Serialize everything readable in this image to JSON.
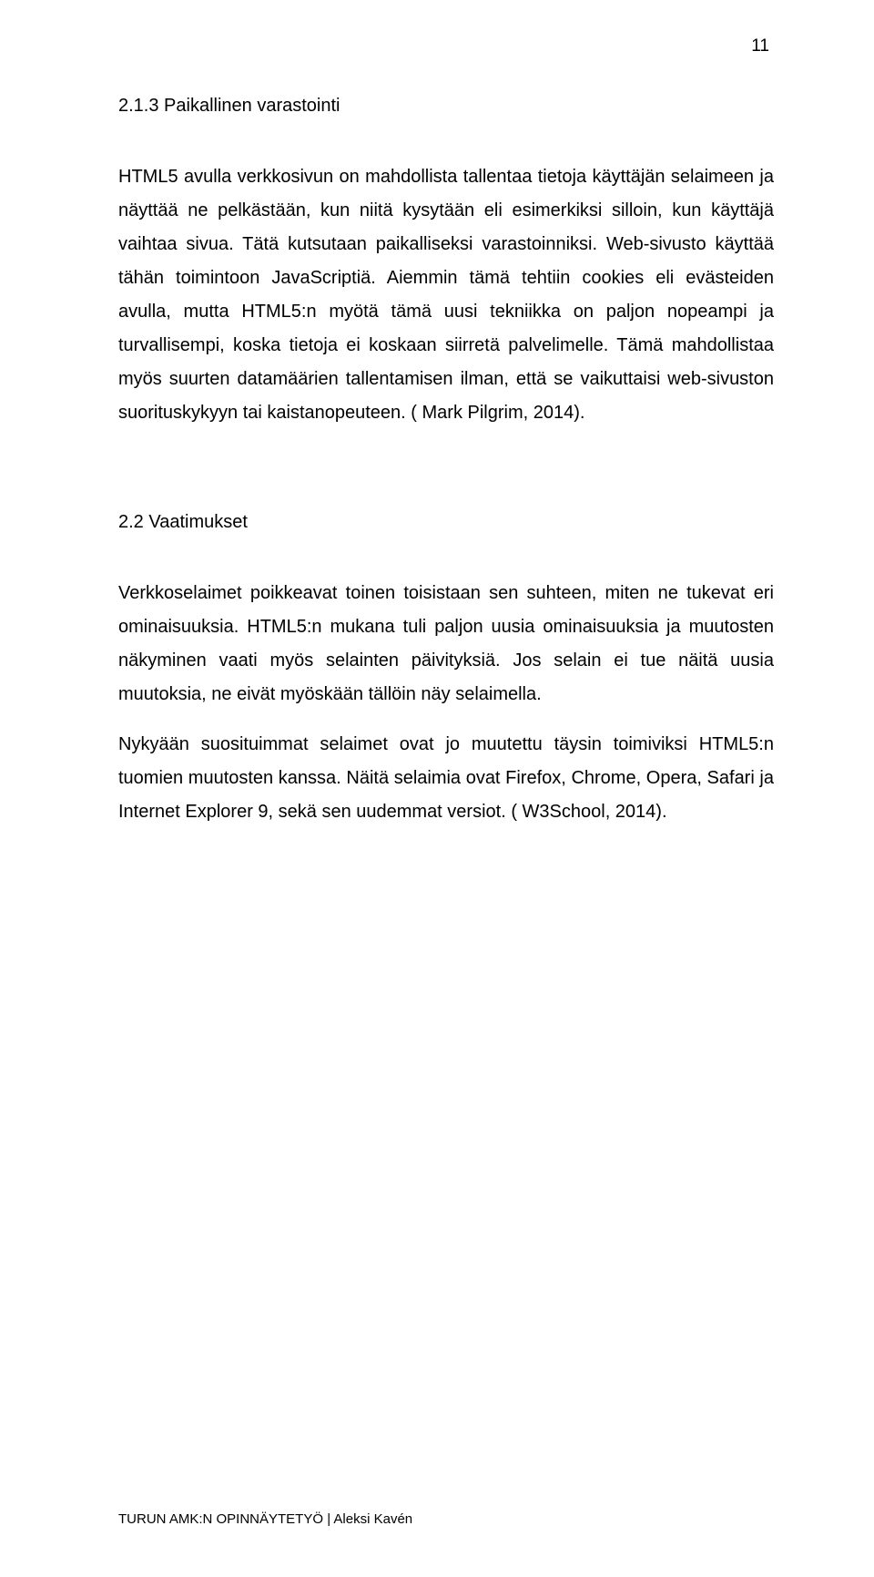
{
  "page_number": "11",
  "section1": {
    "heading": "2.1.3 Paikallinen varastointi",
    "paragraph": "HTML5 avulla verkkosivun on mahdollista tallentaa tietoja käyttäjän selaimeen ja näyttää ne pelkästään, kun niitä kysytään eli esimerkiksi silloin, kun käyttäjä vaihtaa sivua. Tätä kutsutaan paikalliseksi varastoinniksi. Web-sivusto käyttää tähän toimintoon JavaScriptiä. Aiemmin tämä tehtiin cookies eli evästeiden avulla, mutta HTML5:n myötä tämä uusi tekniikka on paljon nopeampi ja turvallisempi, koska tietoja ei koskaan siirretä palvelimelle. Tämä mahdollistaa myös suurten datamäärien tallentamisen ilman, että se vaikuttaisi web-sivuston suorituskykyyn tai kaistanopeuteen. ( Mark Pilgrim, 2014)."
  },
  "section2": {
    "heading": "2.2 Vaatimukset",
    "paragraph1": "Verkkoselaimet poikkeavat toinen toisistaan sen suhteen, miten ne tukevat eri ominaisuuksia. HTML5:n mukana tuli paljon uusia ominaisuuksia ja muutosten näkyminen vaati myös selainten päivityksiä. Jos selain ei tue näitä uusia muutoksia, ne eivät myöskään tällöin näy selaimella.",
    "paragraph2": "Nykyään suosituimmat selaimet ovat jo muutettu täysin toimiviksi HTML5:n tuomien muutosten kanssa. Näitä selaimia ovat Firefox, Chrome, Opera, Safari ja Internet Explorer 9, sekä sen uudemmat versiot. ( W3School, 2014)."
  },
  "footer": "TURUN AMK:N OPINNÄYTETYÖ | Aleksi Kavén"
}
